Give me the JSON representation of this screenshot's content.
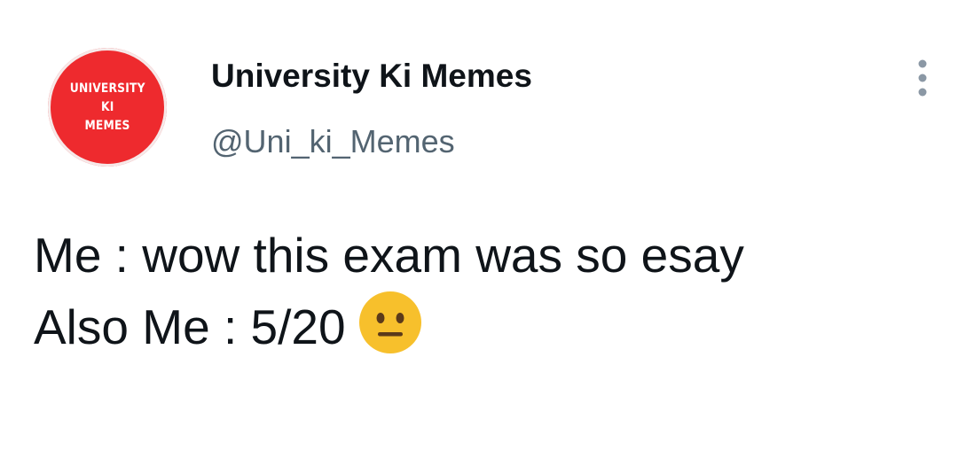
{
  "account": {
    "avatar_lines": [
      "UNIVERSITY",
      "KI",
      "MEMES"
    ],
    "display_name": "University Ki Memes",
    "handle": "@Uni_ki_Memes"
  },
  "tweet": {
    "line1": "Me : wow this exam was so esay",
    "line2": "Also Me : 5/20",
    "emoji": "neutral-face-icon"
  },
  "menu": {
    "icon": "more-vertical-icon"
  },
  "colors": {
    "avatar_bg": "#ee2a2e",
    "text": "#0f1419",
    "handle": "#536471",
    "emoji_face": "#f7c02c"
  }
}
